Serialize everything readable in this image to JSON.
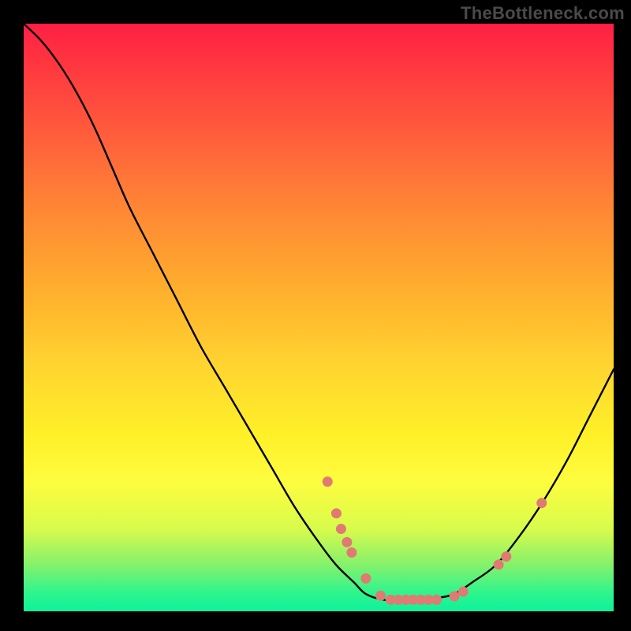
{
  "attribution": "TheBottleneck.com",
  "chart_data": {
    "type": "line",
    "title": "",
    "xlabel": "",
    "ylabel": "",
    "xlim": [
      0,
      100
    ],
    "ylim": [
      -2,
      100
    ],
    "grid": false,
    "series": [
      {
        "name": "bottleneck-curve",
        "x": [
          0,
          3,
          6,
          9,
          12,
          15,
          18,
          22,
          26,
          30,
          34,
          38,
          42,
          46,
          50,
          53,
          56,
          58,
          61,
          64,
          67,
          70,
          73,
          76,
          80,
          84,
          88,
          92,
          96,
          100
        ],
        "y": [
          100,
          97,
          93,
          88,
          82,
          75,
          68,
          60,
          52,
          44,
          37,
          30,
          23,
          16,
          10,
          6,
          3,
          1,
          0,
          0,
          0,
          0.3,
          1,
          3,
          6,
          11,
          17,
          24,
          32,
          40
        ]
      }
    ],
    "scatter_points": {
      "name": "highlight-dots",
      "color": "#e07a73",
      "points": [
        {
          "x": 51.5,
          "y": 20.5
        },
        {
          "x": 53.0,
          "y": 15.0
        },
        {
          "x": 53.8,
          "y": 12.3
        },
        {
          "x": 54.8,
          "y": 10.0
        },
        {
          "x": 55.6,
          "y": 8.2
        },
        {
          "x": 58.0,
          "y": 3.7
        },
        {
          "x": 60.5,
          "y": 0.7
        },
        {
          "x": 62.2,
          "y": 0.0
        },
        {
          "x": 63.5,
          "y": 0.0
        },
        {
          "x": 64.8,
          "y": 0.0
        },
        {
          "x": 66.0,
          "y": 0.0
        },
        {
          "x": 67.3,
          "y": 0.0
        },
        {
          "x": 68.6,
          "y": 0.0
        },
        {
          "x": 70.0,
          "y": 0.0
        },
        {
          "x": 73.0,
          "y": 0.6
        },
        {
          "x": 74.5,
          "y": 1.4
        },
        {
          "x": 80.5,
          "y": 6.1
        },
        {
          "x": 81.8,
          "y": 7.5
        },
        {
          "x": 87.8,
          "y": 16.8
        }
      ]
    }
  }
}
